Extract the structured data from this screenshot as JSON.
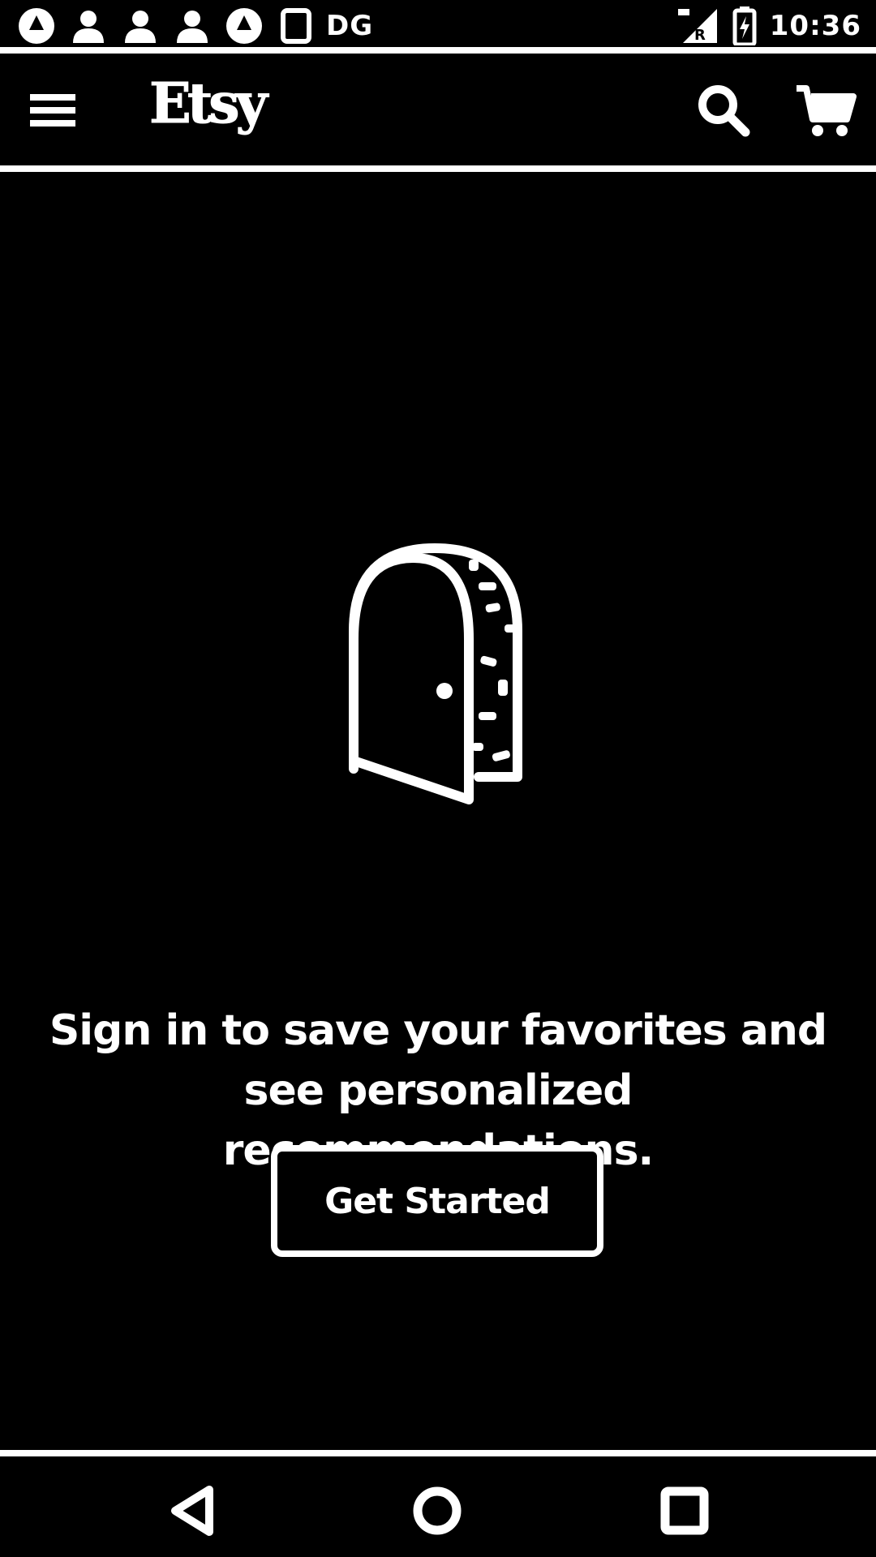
{
  "status_bar": {
    "left_icons": [
      "brand-circle-icon",
      "person-icon",
      "person-icon",
      "person-icon",
      "brand-circle-icon",
      "square-notification-icon"
    ],
    "extra_label": "DG",
    "right_icons": [
      "signal-icon",
      "battery-icon"
    ],
    "time": "10:36"
  },
  "app_bar": {
    "logo_text": "Etsy",
    "menu_icon": "hamburger-menu-icon",
    "search_icon": "search-icon",
    "cart_icon": "cart-icon"
  },
  "empty_state": {
    "illustration": "open-door-icon",
    "message": "Sign in to save your favorites and see personalized recommendations.",
    "button_label": "Get Started"
  },
  "nav_bar": {
    "back_icon": "back-triangle-icon",
    "home_icon": "home-circle-icon",
    "recents_icon": "recents-square-icon"
  },
  "colors": {
    "background": "#000000",
    "foreground": "#ffffff"
  }
}
